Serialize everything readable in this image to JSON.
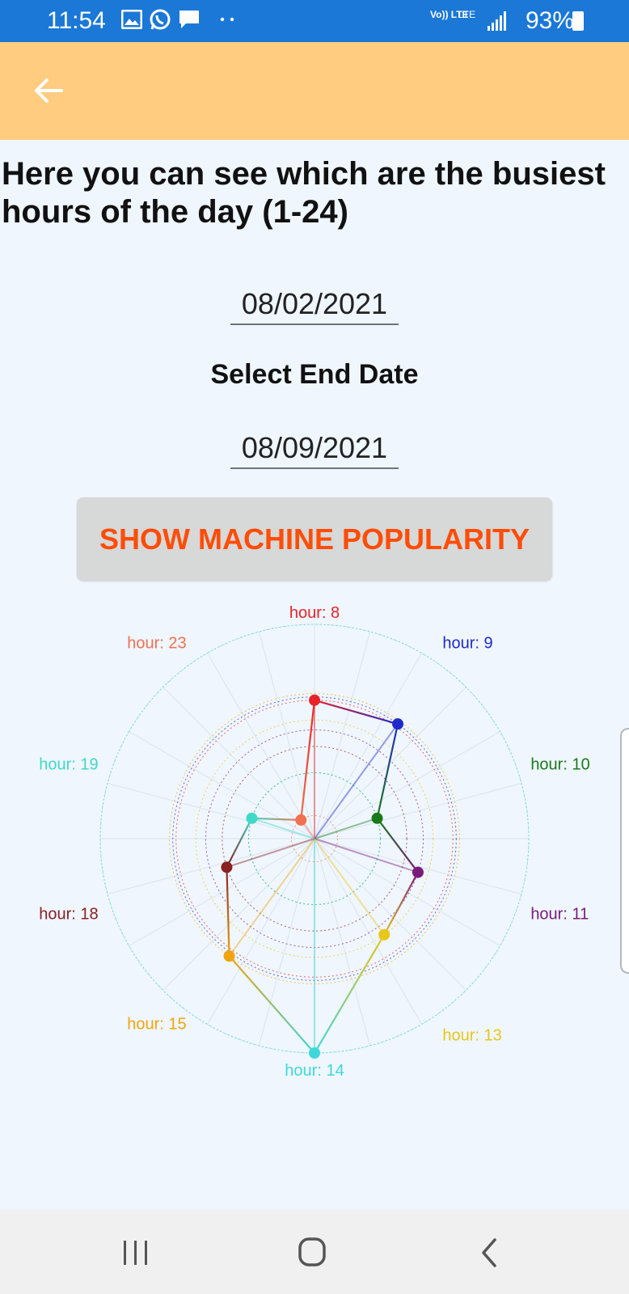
{
  "status": {
    "time": "11:54",
    "signal_lte": "Vo)) LTE",
    "lte2": "LTE",
    "battery": "93%",
    "icons": [
      "image-icon",
      "whatsapp-icon",
      "chat-icon",
      "more-dots-icon",
      "signal-icon",
      "battery-icon"
    ]
  },
  "app_bar": {
    "back_icon": "arrow-left-icon"
  },
  "heading": "Here you can see which are the busiest hours of the day (1-24)",
  "start_date": "08/02/2021",
  "end_label": "Select End Date",
  "end_date": "08/09/2021",
  "show_button": "SHOW MACHINE POPULARITY",
  "accent": "#ff4d06",
  "chart_data": {
    "type": "radar",
    "categories": [
      "hour: 8",
      "hour: 9",
      "hour: 10",
      "hour: 11",
      "hour: 13",
      "hour: 14",
      "hour: 15",
      "hour: 18",
      "hour: 19",
      "hour: 23"
    ],
    "category_colors": [
      "#e8232a",
      "#2029c8",
      "#1a7a1a",
      "#7a1a7a",
      "#e8c61c",
      "#3ed8d8",
      "#f0a410",
      "#8a2020",
      "#40d8c8",
      "#f07050"
    ],
    "values": [
      4.2,
      4.3,
      2.0,
      3.3,
      3.6,
      6.5,
      4.4,
      2.8,
      2.0,
      0.7
    ],
    "rmax": 6.5,
    "grid": true
  },
  "nav": {
    "recent": "recents-icon",
    "home": "home-icon",
    "back": "back-chevron-icon"
  }
}
